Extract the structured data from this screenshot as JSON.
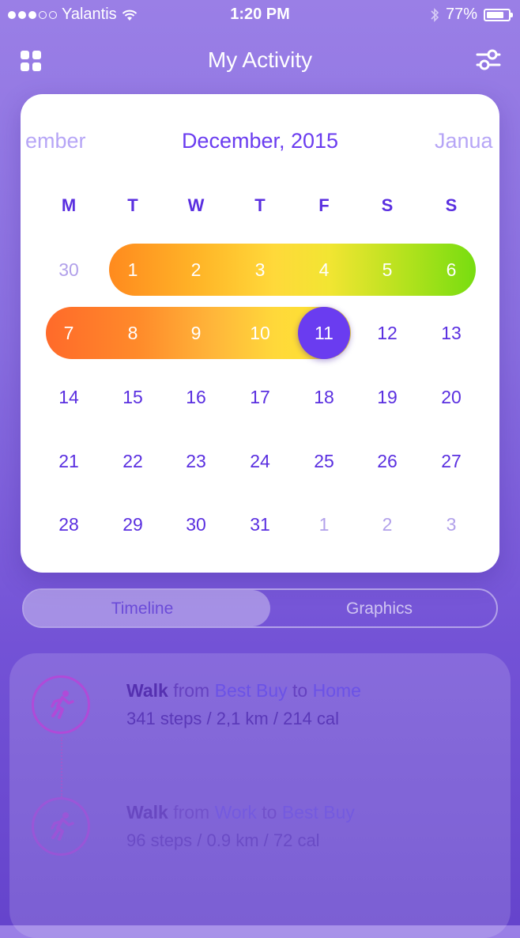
{
  "status_bar": {
    "carrier": "Yalantis",
    "time": "1:20 PM",
    "battery": "77%"
  },
  "header": {
    "title": "My Activity"
  },
  "calendar": {
    "prev_month": "ember",
    "current_month": "December, 2015",
    "next_month": "Janua",
    "weekdays": [
      "M",
      "T",
      "W",
      "T",
      "F",
      "S",
      "S"
    ],
    "weeks": [
      [
        "30",
        "1",
        "2",
        "3",
        "4",
        "5",
        "6"
      ],
      [
        "7",
        "8",
        "9",
        "10",
        "11",
        "12",
        "13"
      ],
      [
        "14",
        "15",
        "16",
        "17",
        "18",
        "19",
        "20"
      ],
      [
        "21",
        "22",
        "23",
        "24",
        "25",
        "26",
        "27"
      ],
      [
        "28",
        "29",
        "30",
        "31",
        "1",
        "2",
        "3"
      ]
    ],
    "selected_day": "11"
  },
  "segmented": {
    "timeline": "Timeline",
    "graphics": "Graphics"
  },
  "activities": [
    {
      "type": "Walk",
      "from_word": "from",
      "from": "Best Buy",
      "to_word": "to",
      "to": "Home",
      "stats": "341 steps / 2,1 km / 214 cal"
    },
    {
      "type": "Walk",
      "from_word": "from",
      "from": "Work",
      "to_word": "to",
      "to": "Best Buy",
      "stats": "96 steps / 0.9 km / 72 cal"
    }
  ]
}
